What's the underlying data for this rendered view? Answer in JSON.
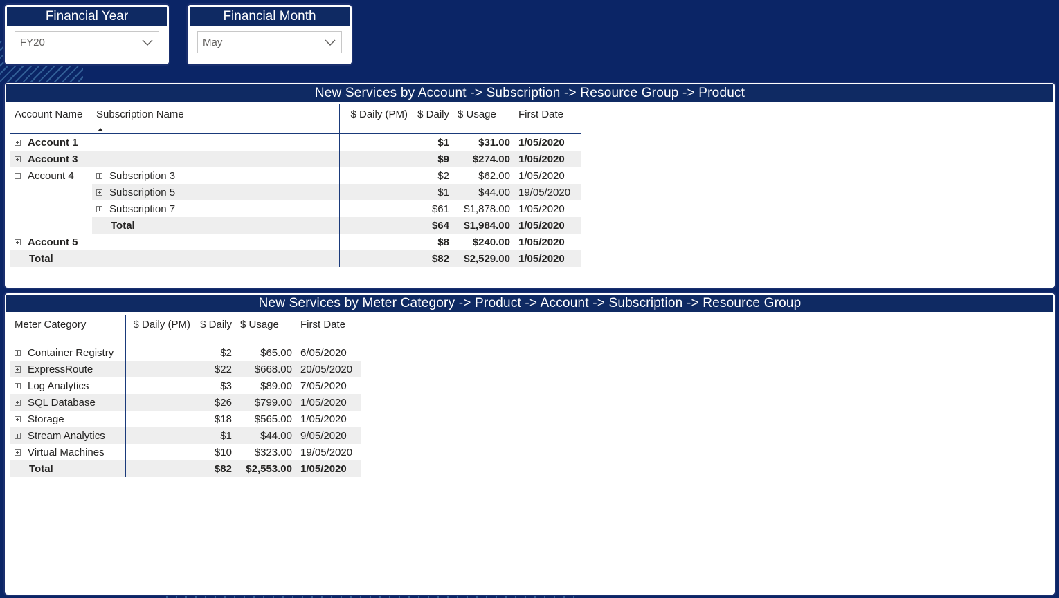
{
  "slicers": {
    "year": {
      "title": "Financial Year",
      "value": "FY20"
    },
    "month": {
      "title": "Financial Month",
      "value": "May"
    }
  },
  "table1": {
    "title": "New Services by Account -> Subscription -> Resource Group -> Product",
    "headers": [
      "Account Name",
      "Subscription Name",
      "$ Daily (PM)",
      "$ Daily",
      "$ Usage",
      "First Date"
    ],
    "rows": [
      {
        "account": "Account 1",
        "sub": "",
        "dpm": "",
        "daily": "$1",
        "usage": "$31.00",
        "date": "1/05/2020"
      },
      {
        "account": "Account 3",
        "sub": "",
        "dpm": "",
        "daily": "$9",
        "usage": "$274.00",
        "date": "1/05/2020"
      },
      {
        "account": "Account 4",
        "sub": "Subscription 3",
        "dpm": "",
        "daily": "$2",
        "usage": "$62.00",
        "date": "1/05/2020"
      },
      {
        "account": "",
        "sub": "Subscription 5",
        "dpm": "",
        "daily": "$1",
        "usage": "$44.00",
        "date": "19/05/2020"
      },
      {
        "account": "",
        "sub": "Subscription 7",
        "dpm": "",
        "daily": "$61",
        "usage": "$1,878.00",
        "date": "1/05/2020"
      },
      {
        "account": "",
        "sub": "Total",
        "dpm": "",
        "daily": "$64",
        "usage": "$1,984.00",
        "date": "1/05/2020"
      },
      {
        "account": "Account 5",
        "sub": "",
        "dpm": "",
        "daily": "$8",
        "usage": "$240.00",
        "date": "1/05/2020"
      },
      {
        "account": "Total",
        "sub": "",
        "dpm": "",
        "daily": "$82",
        "usage": "$2,529.00",
        "date": "1/05/2020"
      }
    ]
  },
  "table2": {
    "title": "New Services by Meter Category -> Product -> Account -> Subscription -> Resource Group",
    "headers": [
      "Meter Category",
      "$ Daily (PM)",
      "$ Daily",
      "$ Usage",
      "First Date"
    ],
    "rows": [
      {
        "cat": "Container Registry",
        "dpm": "",
        "daily": "$2",
        "usage": "$65.00",
        "date": "6/05/2020"
      },
      {
        "cat": "ExpressRoute",
        "dpm": "",
        "daily": "$22",
        "usage": "$668.00",
        "date": "20/05/2020"
      },
      {
        "cat": "Log Analytics",
        "dpm": "",
        "daily": "$3",
        "usage": "$89.00",
        "date": "7/05/2020"
      },
      {
        "cat": "SQL Database",
        "dpm": "",
        "daily": "$26",
        "usage": "$799.00",
        "date": "1/05/2020"
      },
      {
        "cat": "Storage",
        "dpm": "",
        "daily": "$18",
        "usage": "$565.00",
        "date": "1/05/2020"
      },
      {
        "cat": "Stream Analytics",
        "dpm": "",
        "daily": "$1",
        "usage": "$44.00",
        "date": "9/05/2020"
      },
      {
        "cat": "Virtual Machines",
        "dpm": "",
        "daily": "$10",
        "usage": "$323.00",
        "date": "19/05/2020"
      },
      {
        "cat": "Total",
        "dpm": "",
        "daily": "$82",
        "usage": "$2,553.00",
        "date": "1/05/2020"
      }
    ]
  }
}
